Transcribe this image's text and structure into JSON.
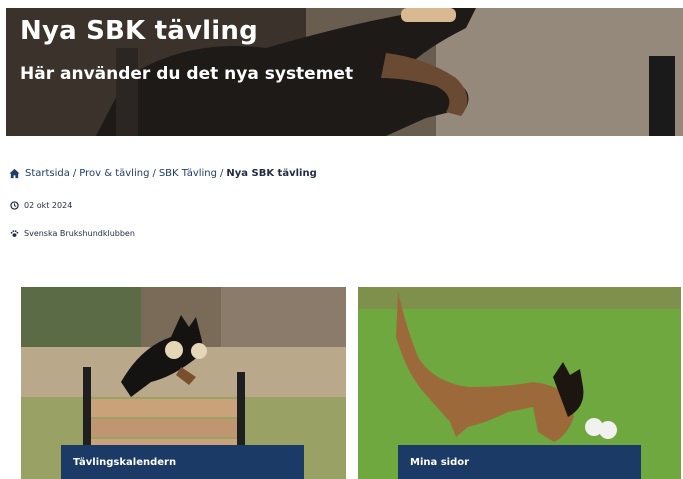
{
  "hero": {
    "title": "Nya SBK tävling",
    "subtitle": "Här använder du det nya systemet"
  },
  "breadcrumb": {
    "items": [
      "Startsida",
      "Prov & tävling",
      "SBK Tävling"
    ],
    "current": "Nya SBK tävling",
    "separator": "/"
  },
  "meta": {
    "date": "02 okt 2024",
    "organization": "Svenska Brukshundklubben"
  },
  "cards": [
    {
      "label": "Tävlingskalendern"
    },
    {
      "label": "Mina sidor"
    }
  ],
  "colors": {
    "brand_navy": "#1b3a66",
    "link": "#1f3d6b"
  }
}
